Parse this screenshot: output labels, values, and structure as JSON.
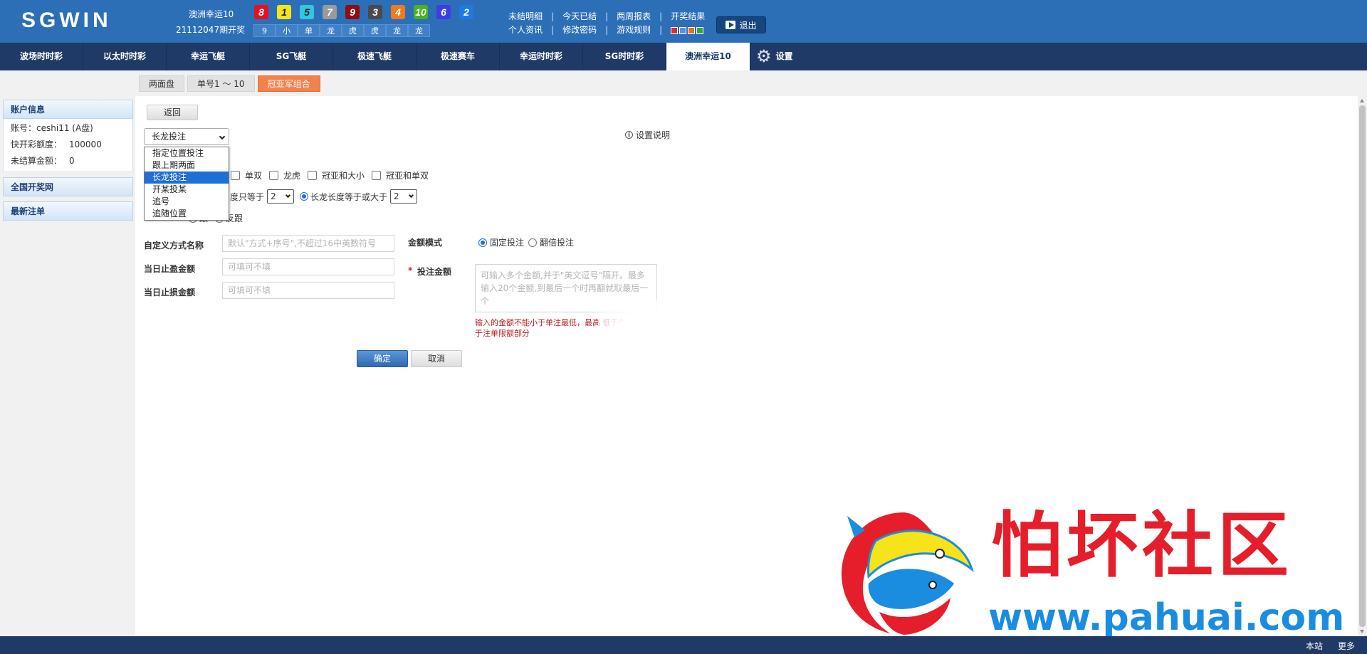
{
  "header": {
    "logo": "SGWIN",
    "game_name": "澳洲幸运10",
    "period": "21112047期开奖",
    "balls": [
      {
        "num": "8",
        "color": "#e8101e"
      },
      {
        "num": "1",
        "color": "#f5e61a"
      },
      {
        "num": "5",
        "color": "#33c6de"
      },
      {
        "num": "7",
        "color": "#9a9a9a"
      },
      {
        "num": "9",
        "color": "#8e0d11"
      },
      {
        "num": "3",
        "color": "#4a4a4a"
      },
      {
        "num": "4",
        "color": "#f17a1c"
      },
      {
        "num": "10",
        "color": "#48b418"
      },
      {
        "num": "6",
        "color": "#3d3de0"
      },
      {
        "num": "2",
        "color": "#1e78e6"
      }
    ],
    "stats": [
      "9",
      "小",
      "单",
      "龙",
      "虎",
      "虎",
      "龙",
      "龙"
    ],
    "links_row1": [
      "未结明细",
      "今天已结",
      "两周报表",
      "开奖结果"
    ],
    "links_row2": [
      "个人资讯",
      "修改密码",
      "游戏规则"
    ],
    "skin_colors": [
      "#d92f2f",
      "#5b8fe0",
      "#e86e1c",
      "#3aa33a"
    ],
    "logout_label": "退出"
  },
  "nav": {
    "items": [
      "波场时时彩",
      "以太时时彩",
      "幸运飞艇",
      "SG飞艇",
      "极速飞艇",
      "极速赛车",
      "幸运时时彩",
      "SG时时彩",
      "澳洲幸运10"
    ],
    "active_index": 8,
    "settings_label": "设置"
  },
  "subtabs": {
    "items": [
      "两面盘",
      "单号1 ～ 10",
      "冠亚军组合"
    ],
    "active_index": 2
  },
  "sidebar": {
    "account_title": "账户信息",
    "account_label": "账号：",
    "account_value": "ceshi11 (A盘)",
    "quick_label": "快开彩额度：",
    "quick_value": "100000",
    "unsettled_label": "未结算金额：",
    "unsettled_value": "0",
    "lottery_site": "全国开奖网",
    "latest_bets": "最新注单"
  },
  "form": {
    "back_label": "返回",
    "help_label": "设置说明",
    "mode_selected": "长龙投注",
    "mode_options": [
      "指定位置投注",
      "跟上期两面",
      "长龙投注",
      "开某投某",
      "追号",
      "追随位置"
    ],
    "mode_selected_index": 2,
    "type_options": [
      "单双",
      "龙虎",
      "冠亚和大小",
      "冠亚和单双"
    ],
    "len_prefix": "度只等于",
    "len_eq_value": "2",
    "len_ge_label": "长龙长度等于或大于",
    "len_ge_value": "2",
    "follow_partial": "跟",
    "follow_reverse": "反跟",
    "custom_name_label": "自定义方式名称",
    "custom_name_placeholder": "默认\"方式+序号\",不超过16中英数符号",
    "stop_win_label": "当日止盈金额",
    "stop_win_placeholder": "可填可不填",
    "stop_loss_label": "当日止损金额",
    "stop_loss_placeholder": "可填可不填",
    "amount_mode_label": "金额模式",
    "amount_fixed": "固定投注",
    "amount_double": "翻倍投注",
    "required_mark": "*",
    "amount_label": "投注金额",
    "amount_placeholder": "可输入多个金额,并于\"英文逗号\"隔开。最多输入20个金额,到最后一个时再翻就取最后一个",
    "amount_hint": "输入的金额不能小于单注最低，最高 低于单注最低或大于注单限额部分",
    "ok_label": "确定",
    "cancel_label": "取消"
  },
  "footer": {
    "this_site": "本站",
    "more": "更多"
  },
  "watermark": {
    "title": "怕坏社区",
    "url": "www.pahuai.com"
  }
}
